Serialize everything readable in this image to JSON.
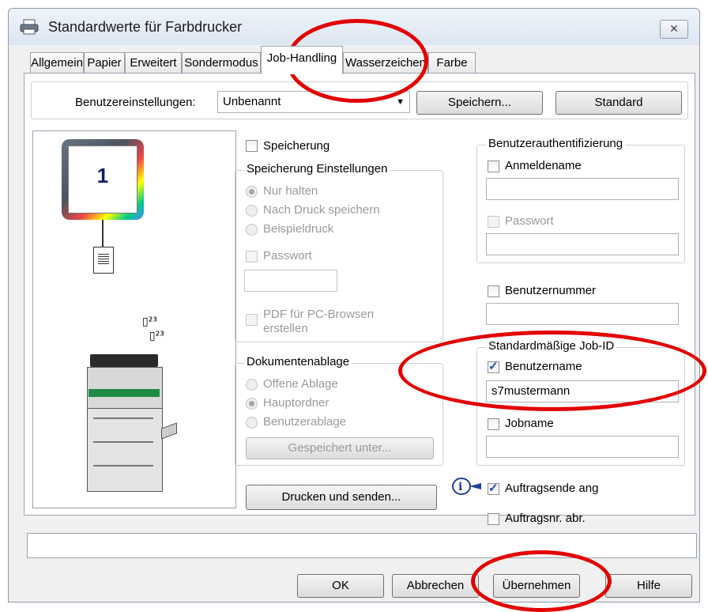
{
  "window": {
    "title": "Standardwerte für Farbdrucker",
    "close_glyph": "✕"
  },
  "tabs": [
    {
      "label": "Allgemein"
    },
    {
      "label": "Papier"
    },
    {
      "label": "Erweitert"
    },
    {
      "label": "Sondermodus"
    },
    {
      "label": "Job-Handling",
      "active": true
    },
    {
      "label": "Wasserzeichen"
    },
    {
      "label": "Farbe"
    }
  ],
  "settings_row": {
    "label": "Benutzereinstellungen:",
    "value": "Unbenannt",
    "save_button": "Speichern...",
    "default_button": "Standard"
  },
  "preview": {
    "page_number": "1"
  },
  "storage": {
    "checkbox_label": "Speicherung",
    "group_title": "Speicherung Einstellungen",
    "options": [
      "Nur halten",
      "Nach Druck speichern",
      "Beispieldruck"
    ],
    "password_label": "Passwort",
    "pdf_label_line1": "PDF für PC-Browsen",
    "pdf_label_line2": "erstellen"
  },
  "filing": {
    "group_title": "Dokumentenablage",
    "options": [
      "Offene Ablage",
      "Hauptordner",
      "Benutzerablage"
    ],
    "saved_under_button": "Gespeichert unter..."
  },
  "print_send_button": "Drucken und senden...",
  "auth": {
    "group_title": "Benutzerauthentifizierung",
    "login_label": "Anmeldename",
    "password_label": "Passwort"
  },
  "user_number_label": "Benutzernummer",
  "job_id": {
    "group_title": "Standardmäßige Job-ID",
    "username_label": "Benutzername",
    "username_value": "s7mustermann",
    "jobname_label": "Jobname"
  },
  "job_end_label": "Auftragsende ang",
  "job_number_label": "Auftragsnr. abr.",
  "footer": {
    "ok": "OK",
    "cancel": "Abbrechen",
    "apply": "Übernehmen",
    "help": "Hilfe"
  },
  "colors": {
    "annotation": "#e30000",
    "check": "#1c4fb3"
  }
}
